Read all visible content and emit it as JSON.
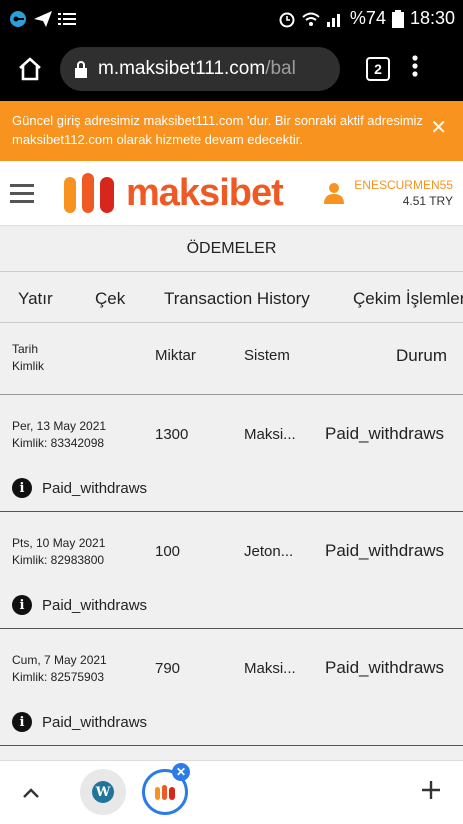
{
  "status_bar": {
    "time": "18:30",
    "battery": "%74",
    "left_icons": [
      "vpn-key-icon",
      "send-icon",
      "list-icon"
    ],
    "right_icons": [
      "alarm-icon",
      "wifi-icon",
      "signal-icon",
      "battery-icon"
    ]
  },
  "browser": {
    "url_main": "m.maksibet111.com",
    "url_dim": "/bal",
    "tab_count": "2"
  },
  "notice": {
    "text": "Güncel giriş adresimiz maksibet111.com 'dur. Bir sonraki aktif adresimiz maksibet112.com olarak hizmete devam edecektir.",
    "close": "✕"
  },
  "header": {
    "logo_text": "maksibet",
    "username": "ENESCURMEN55",
    "balance": "4.51 TRY"
  },
  "page_title": "ÖDEMELER",
  "tabs": [
    {
      "label": "Yatır",
      "active": false
    },
    {
      "label": "Çek",
      "active": false
    },
    {
      "label": "Transaction History",
      "active": false
    },
    {
      "label": "Çekim İşlemleri",
      "active": true
    }
  ],
  "table": {
    "headers": {
      "date": "Tarih",
      "id": "Kimlik",
      "amount": "Miktar",
      "system": "Sistem",
      "status": "Durum"
    },
    "rows": [
      {
        "date": "Per, 13 May 2021",
        "id": "Kimlik: 83342098",
        "amount": "1300",
        "system": "Maksi...",
        "status": "Paid_withdraws",
        "info": "Paid_withdraws"
      },
      {
        "date": "Pts, 10 May 2021",
        "id": "Kimlik: 82983800",
        "amount": "100",
        "system": "Jeton...",
        "status": "Paid_withdraws",
        "info": "Paid_withdraws"
      },
      {
        "date": "Cum, 7 May 2021",
        "id": "Kimlik: 82575903",
        "amount": "790",
        "system": "Maksi...",
        "status": "Paid_withdraws",
        "info": "Paid_withdraws"
      }
    ]
  },
  "colors": {
    "accent": "#f7931e",
    "brand": "#ef5a24",
    "tab_active_blue": "#2d7be8"
  }
}
